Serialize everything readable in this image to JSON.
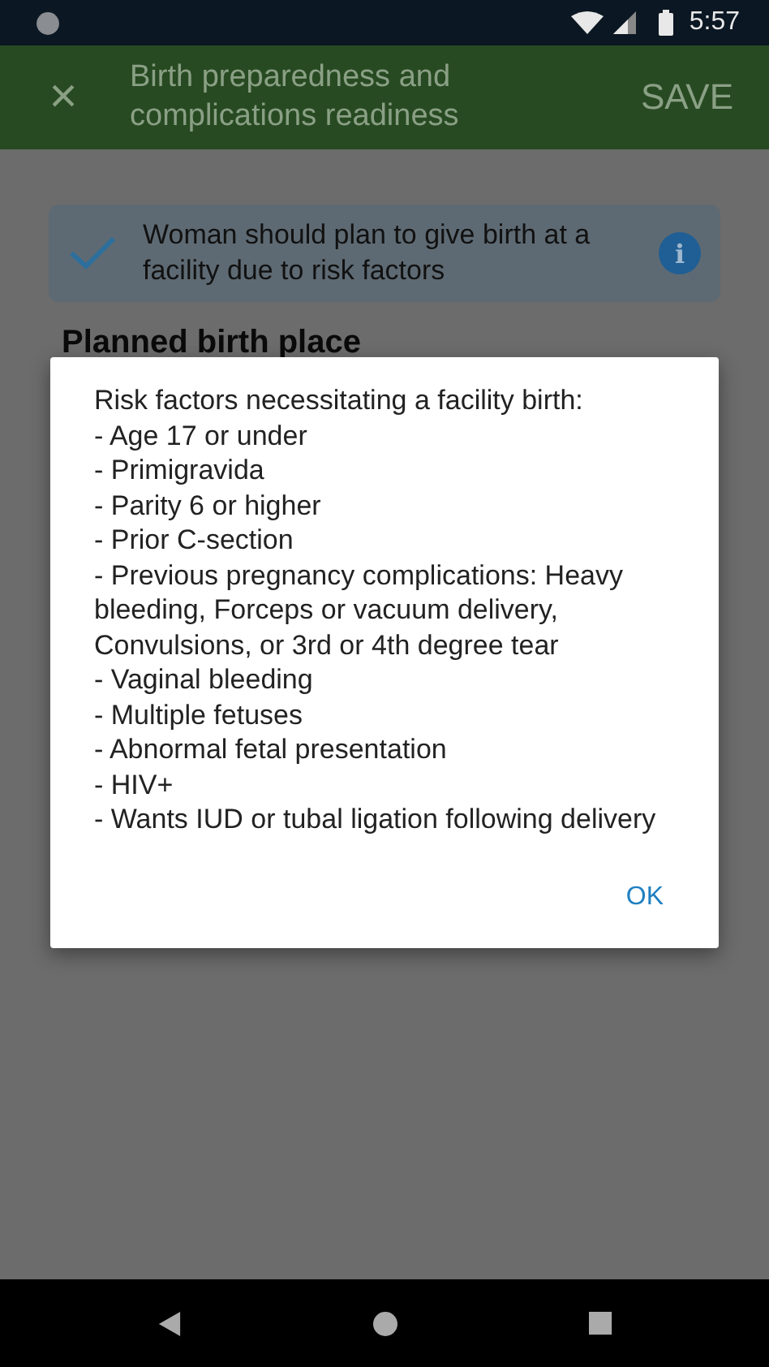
{
  "status_bar": {
    "time": "5:57"
  },
  "app_bar": {
    "close": "×",
    "title": "Birth preparedness and complications readiness",
    "action": "SAVE"
  },
  "notice": {
    "checked": true,
    "text": "Woman should plan to give birth at a facility due to risk factors",
    "info": "i"
  },
  "section_heading": "Planned birth place",
  "dialog": {
    "title": "Risk factors necessitating a facility birth:",
    "items": [
      "- Age 17 or under",
      "- Primigravida",
      "- Parity 6 or higher",
      "- Prior C-section",
      "- Previous pregnancy complications: Heavy bleeding, Forceps or vacuum delivery, Convulsions, or 3rd or 4th degree tear",
      "- Vaginal bleeding",
      "- Multiple fetuses",
      "- Abnormal fetal presentation",
      "- HIV+",
      "- Wants IUD or tubal ligation following delivery"
    ],
    "button": "OK"
  }
}
